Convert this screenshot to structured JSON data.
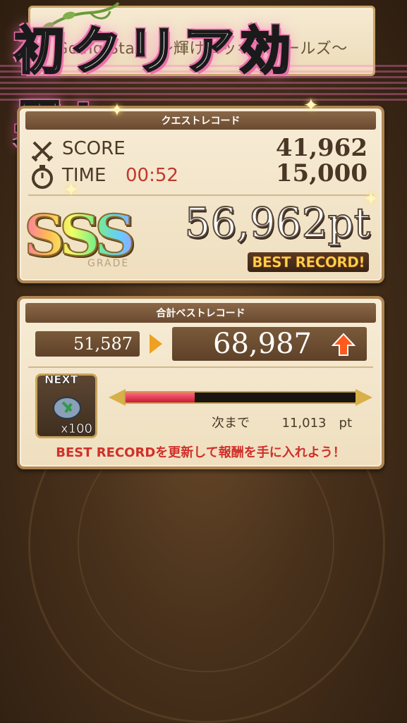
{
  "quest": {
    "title": "Going Star　〜輝けロッキンガールズ〜"
  },
  "overlay": {
    "caption": "初クリア効果！",
    "color_pink": "#e86fa8"
  },
  "quest_record": {
    "header": "クエストレコード",
    "score_label": "SCORE",
    "score_value": "41,962",
    "time_label": "TIME",
    "time_value": "00:52",
    "time_points": "15,000",
    "grade": "SSS",
    "grade_caption": "GRADE",
    "total": "56,962pt",
    "best_tag": "BEST RECORD!"
  },
  "total_best": {
    "header": "合計ベストレコード",
    "previous": "51,587",
    "new": "68,987",
    "reward_label": "NEXT",
    "reward_qty": "x100",
    "reward_icon": "gem-icon",
    "progress": 0.3,
    "remain_label": "次まで",
    "remain_value": "11,013　pt",
    "message": "BEST RECORDを更新して報酬を手に入れよう！"
  }
}
